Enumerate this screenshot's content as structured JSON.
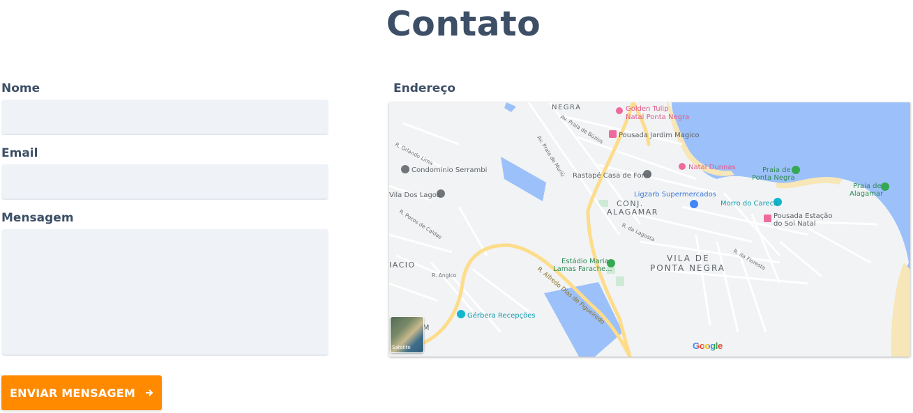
{
  "page": {
    "title": "Contato"
  },
  "form": {
    "name_label": "Nome",
    "email_label": "Email",
    "message_label": "Mensagem",
    "name_value": "",
    "email_value": "",
    "message_value": "",
    "submit_label": "ENVIAR MENSAGEM",
    "submit_icon": "arrow-right-icon",
    "accent_color": "#ff8a00"
  },
  "address": {
    "label": "Endereço",
    "map": {
      "neighborhoods": [
        "NEGRA",
        "CONJ.",
        "ALAGAMAR",
        "VILA DE",
        "PONTA NEGRA",
        "IACIO",
        "M"
      ],
      "places": [
        {
          "name": "Golden Tulip",
          "line2": "Natal Ponta Negra",
          "type": "hotel"
        },
        {
          "name": "Pousada Jardim Magico",
          "type": "hotel"
        },
        {
          "name": "Natal Dunnas",
          "type": "hotel"
        },
        {
          "name": "Praia de",
          "line2": "Ponta Negra",
          "type": "park"
        },
        {
          "name": "Praia de",
          "line2": "Alagamar",
          "type": "park"
        },
        {
          "name": "Condomínio Serrambi",
          "type": "pin"
        },
        {
          "name": "Vila Dos Lagos",
          "type": "pin"
        },
        {
          "name": "Rastapé Casa de Forró",
          "type": "pin"
        },
        {
          "name": "Ligzarb Supermercados",
          "type": "shop"
        },
        {
          "name": "Morro do Careca",
          "type": "attraction"
        },
        {
          "name": "Pousada Estação",
          "line2": "do Sol Natal",
          "type": "hotel"
        },
        {
          "name": "Estádio Maria",
          "line2": "Lamas Farache...",
          "type": "park"
        },
        {
          "name": "Gérbera Recepções",
          "type": "attraction"
        }
      ],
      "streets": [
        "Av. Praia de Búzios",
        "Av. Praia de Muriú",
        "R. Alfredo Dias de Figueiredo",
        "R. da Lagosta",
        "R. Angico",
        "R. da Floresta",
        "R. Pocos de Caldas",
        "R. Orlando Lima"
      ],
      "satellite_label": "Satélite",
      "brand": "Google"
    }
  }
}
